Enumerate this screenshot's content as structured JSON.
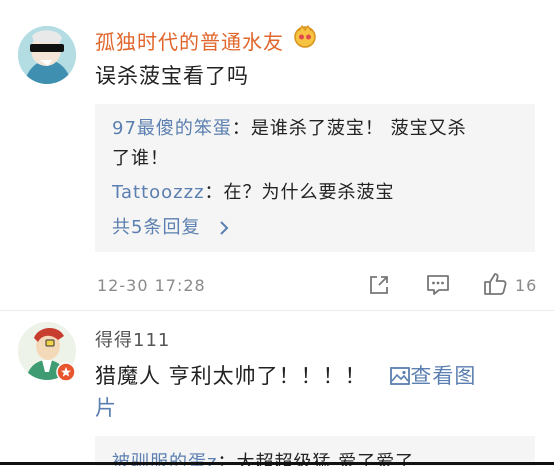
{
  "comment1": {
    "username": "孤独时代的普通水友",
    "text": "误杀菠宝看了吗",
    "replies": [
      {
        "name": "97最傻的笨蛋",
        "sep": "：",
        "text": "是谁杀了菠宝！ 菠宝又杀",
        "text_cont": "了谁！"
      },
      {
        "name": "Tattoozzz",
        "sep": "：",
        "text": "在？为什么要杀菠宝"
      }
    ],
    "more_replies": "共5条回复",
    "timestamp": "12-30 17:28",
    "like_count": "16"
  },
  "comment2": {
    "username": "得得111",
    "text": "猎魔人 亨利太帅了！！！！",
    "view_image": "查看图",
    "view_image_cont": "片",
    "partial_reply": {
      "name": "被驯服的蛋z",
      "sep": "：",
      "text": "大超超级猛 爱了爱了"
    }
  },
  "colors": {
    "username": "#e0662c",
    "link": "#5b7fb0",
    "meta": "#8a8a8a"
  }
}
